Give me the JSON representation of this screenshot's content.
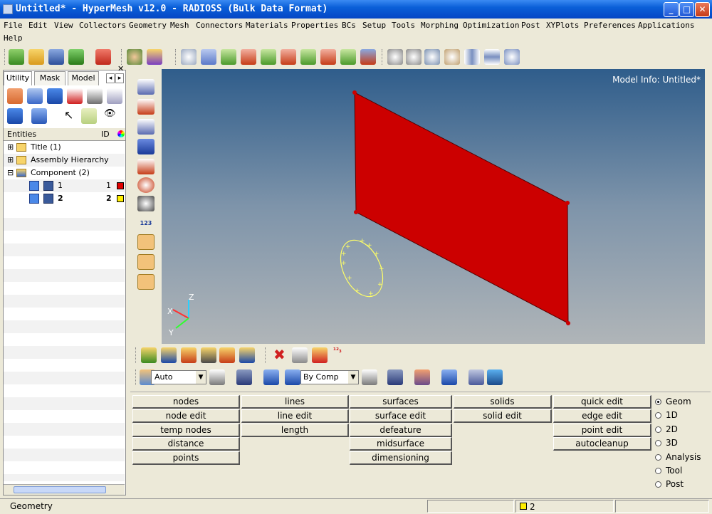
{
  "window": {
    "title": "Untitled* - HyperMesh v12.0 - RADIOSS (Bulk Data Format)",
    "min": "_",
    "max": "□",
    "close": "✕"
  },
  "menu": [
    "File",
    "Edit",
    "View",
    "Collectors",
    "Geometry",
    "Mesh",
    "Connectors",
    "Materials",
    "Properties",
    "BCs",
    "Setup",
    "Tools",
    "Morphing",
    "Optimization",
    "Post",
    "XYPlots",
    "Preferences",
    "Applications",
    "Help"
  ],
  "left": {
    "tabs": [
      "Utility",
      "Mask",
      "Model"
    ],
    "cols": {
      "entities": "Entities",
      "id": "ID"
    },
    "tree": [
      {
        "label": "Title (1)",
        "id": ""
      },
      {
        "label": "Assembly Hierarchy",
        "id": ""
      },
      {
        "label": "Component (2)",
        "id": ""
      },
      {
        "label": "1",
        "id": "1",
        "color": "#e00000"
      },
      {
        "label": "2",
        "id": "2",
        "color": "#ffee00"
      }
    ]
  },
  "viewport": {
    "model_info": "Model Info: Untitled*",
    "axis": {
      "x": "X",
      "y": "Y",
      "z": "Z"
    }
  },
  "bottom": {
    "auto": "Auto",
    "bycomp": "By Comp"
  },
  "panels": {
    "col1": [
      "nodes",
      "node edit",
      "temp nodes",
      "distance",
      "points"
    ],
    "col2": [
      "lines",
      "line edit",
      "length"
    ],
    "col3": [
      "surfaces",
      "surface edit",
      "defeature",
      "midsurface",
      "dimensioning"
    ],
    "col4": [
      "solids",
      "solid edit"
    ],
    "col5": [
      "quick edit",
      "edge edit",
      "point edit",
      "autocleanup"
    ]
  },
  "modes": [
    {
      "label": "Geom",
      "on": true
    },
    {
      "label": "1D"
    },
    {
      "label": "2D"
    },
    {
      "label": "3D"
    },
    {
      "label": "Analysis"
    },
    {
      "label": "Tool"
    },
    {
      "label": "Post"
    }
  ],
  "status": {
    "left": "Geometry",
    "comp": "2",
    "comp_color": "#ffee00"
  },
  "colors": {
    "surface": "#cc0000",
    "circle": "#ffff66"
  }
}
